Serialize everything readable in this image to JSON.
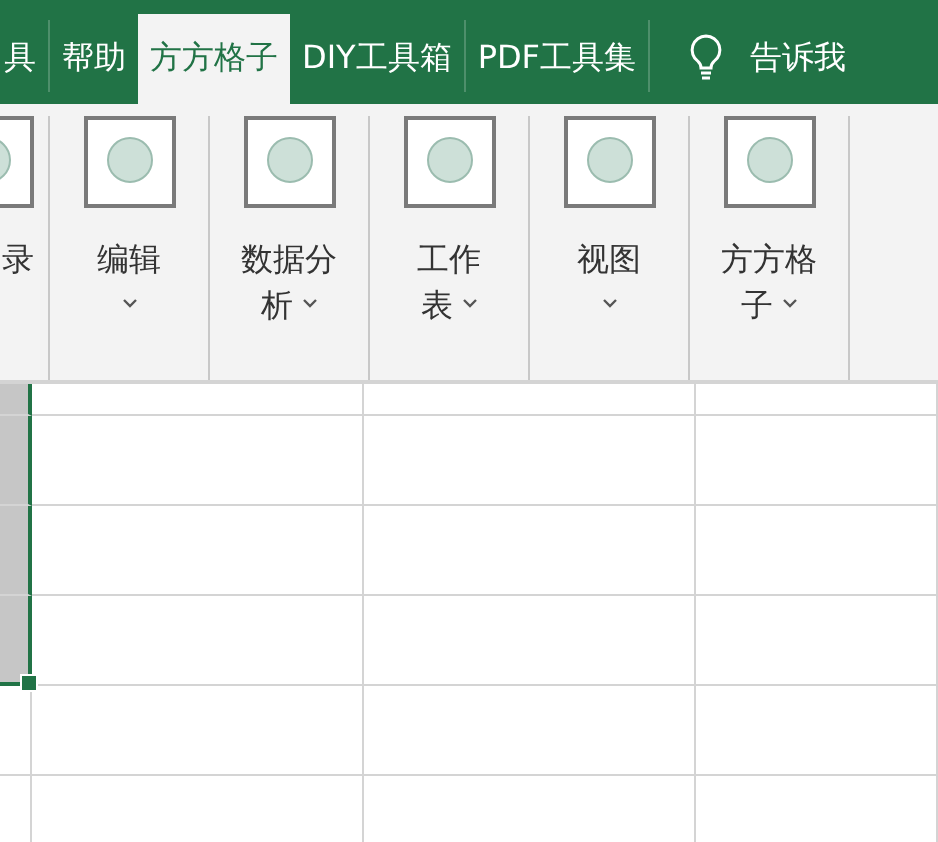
{
  "tabs": [
    {
      "label": "具",
      "selected": false
    },
    {
      "label": "帮助",
      "selected": false
    },
    {
      "label": "方方格子",
      "selected": true
    },
    {
      "label": "DIY工具箱",
      "selected": false
    },
    {
      "label": "PDF工具集",
      "selected": false
    }
  ],
  "tell_me": {
    "label": "告诉我"
  },
  "ribbon_groups": [
    {
      "kind": "partial",
      "label": [
        "录"
      ]
    },
    {
      "kind": "button",
      "label": [
        "编辑"
      ]
    },
    {
      "kind": "button",
      "label": [
        "数据分",
        "析"
      ]
    },
    {
      "kind": "button",
      "label": [
        "工作",
        "表"
      ]
    },
    {
      "kind": "button",
      "label": [
        "视图"
      ]
    },
    {
      "kind": "button",
      "label": [
        "方方格",
        "子"
      ]
    },
    {
      "kind": "empty"
    }
  ],
  "sheet": {
    "rows": [
      {
        "cells": [
          {
            "selected": true
          },
          {
            "selected": false
          },
          {
            "selected": false
          },
          {
            "selected": false
          }
        ]
      },
      {
        "cells": [
          {
            "selected": true
          },
          {
            "selected": false
          },
          {
            "selected": false
          },
          {
            "selected": false
          }
        ]
      },
      {
        "cells": [
          {
            "selected": true
          },
          {
            "selected": false
          },
          {
            "selected": false
          },
          {
            "selected": false
          }
        ]
      },
      {
        "cells": [
          {
            "selected": true
          },
          {
            "selected": false
          },
          {
            "selected": false
          },
          {
            "selected": false
          }
        ]
      },
      {
        "cells": [
          {
            "selected": false
          },
          {
            "selected": false
          },
          {
            "selected": false
          },
          {
            "selected": false
          }
        ]
      },
      {
        "cells": [
          {
            "selected": false
          },
          {
            "selected": false
          },
          {
            "selected": false
          },
          {
            "selected": false
          }
        ]
      }
    ]
  }
}
